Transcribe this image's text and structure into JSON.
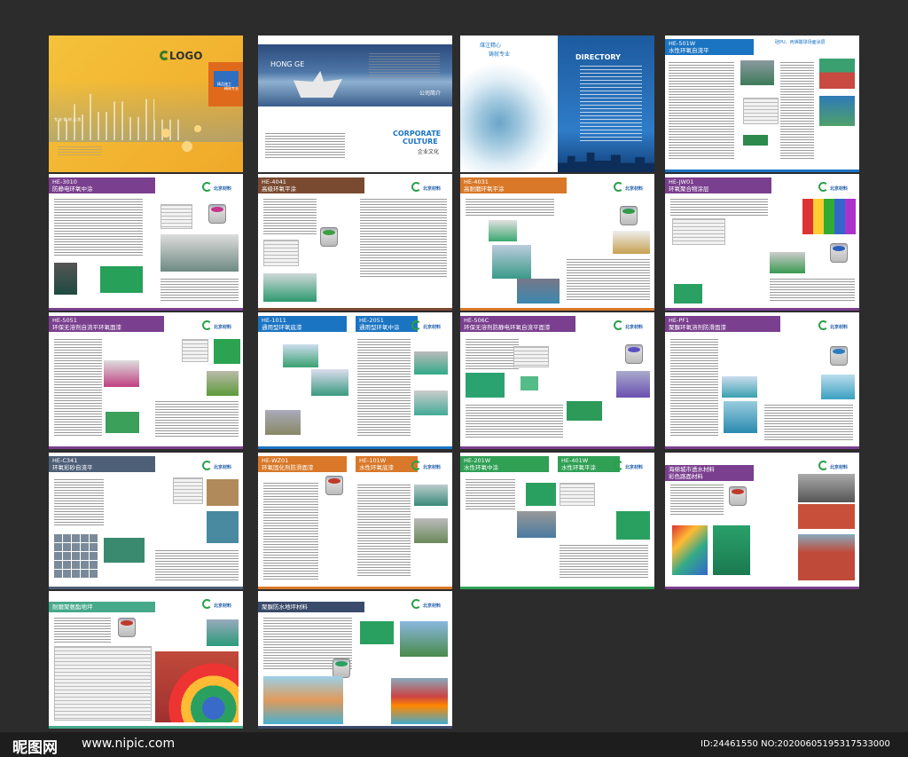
{
  "cover": {
    "logo": "LOGO",
    "subtitle": "专 业 钢 材 品 质",
    "tag_lines": [
      "精品施工",
      "精致专业"
    ]
  },
  "intro": {
    "heading": "HONG GE",
    "title": "公司简介",
    "culture_en_1": "CORPORATE",
    "culture_en_2": "CULTURE",
    "culture_cn": "企业文化"
  },
  "directory": {
    "slogan_1": "煤注精心",
    "slogan_2": "铸就专业",
    "title": "DIRECTORY"
  },
  "brand": "北京材料",
  "pages": [
    {
      "code": "HE-501W",
      "title": "水性环氧自流平",
      "extra": "硅PU、丙烯酸球场面涂层"
    },
    {
      "code": "HE-3010",
      "title": "防静电环氧中涂"
    },
    {
      "code": "HE-4041",
      "title": "高级环氧平涂"
    },
    {
      "code": "HE-4031",
      "title": "高耐磨环氧平涂"
    },
    {
      "code": "HE-JW01",
      "title": "环氧聚合物涂层"
    },
    {
      "code": "HE-5051",
      "title": "环保无溶剂自流平环氧面漆"
    },
    {
      "code": "HE-1011",
      "title": "通用型环氧底漆",
      "code2": "HE-2051",
      "title2": "通用型环氧中涂"
    },
    {
      "code": "HE-506C",
      "title": "环保无溶剂防静电环氧自流平面漆"
    },
    {
      "code": "HE-PF1",
      "title": "聚脲环氧溶剂防滑面漆"
    },
    {
      "code": "HE-C341",
      "title": "环氧彩砂自流平"
    },
    {
      "code": "HE-WZ01",
      "title": "环氧固化剂防滑面漆",
      "code2": "HE-101W",
      "title2": "水性环氧底漆"
    },
    {
      "code": "HE-201W",
      "title": "水性环氧中涂",
      "code2": "HE-401W",
      "title2": "水性环氧平涂"
    },
    {
      "code": "",
      "title": "海绵城市透水材料",
      "title2": "彩色路面材料"
    },
    {
      "code": "",
      "title": "耐磨聚氨酯地坪"
    },
    {
      "code": "",
      "title": "聚脲防水地坪材料"
    }
  ],
  "footer": {
    "site_name": "昵图网",
    "url": "www.nipic.com",
    "image_id": "ID:24461550 NO:20200605195317533000"
  },
  "colors": {
    "background": "#2c2c2c",
    "purple": "#7a3f8e",
    "blue": "#1b74c2",
    "brown": "#7a4a30",
    "orange": "#d87828",
    "teal": "#46a98a",
    "green": "#2fa054"
  }
}
